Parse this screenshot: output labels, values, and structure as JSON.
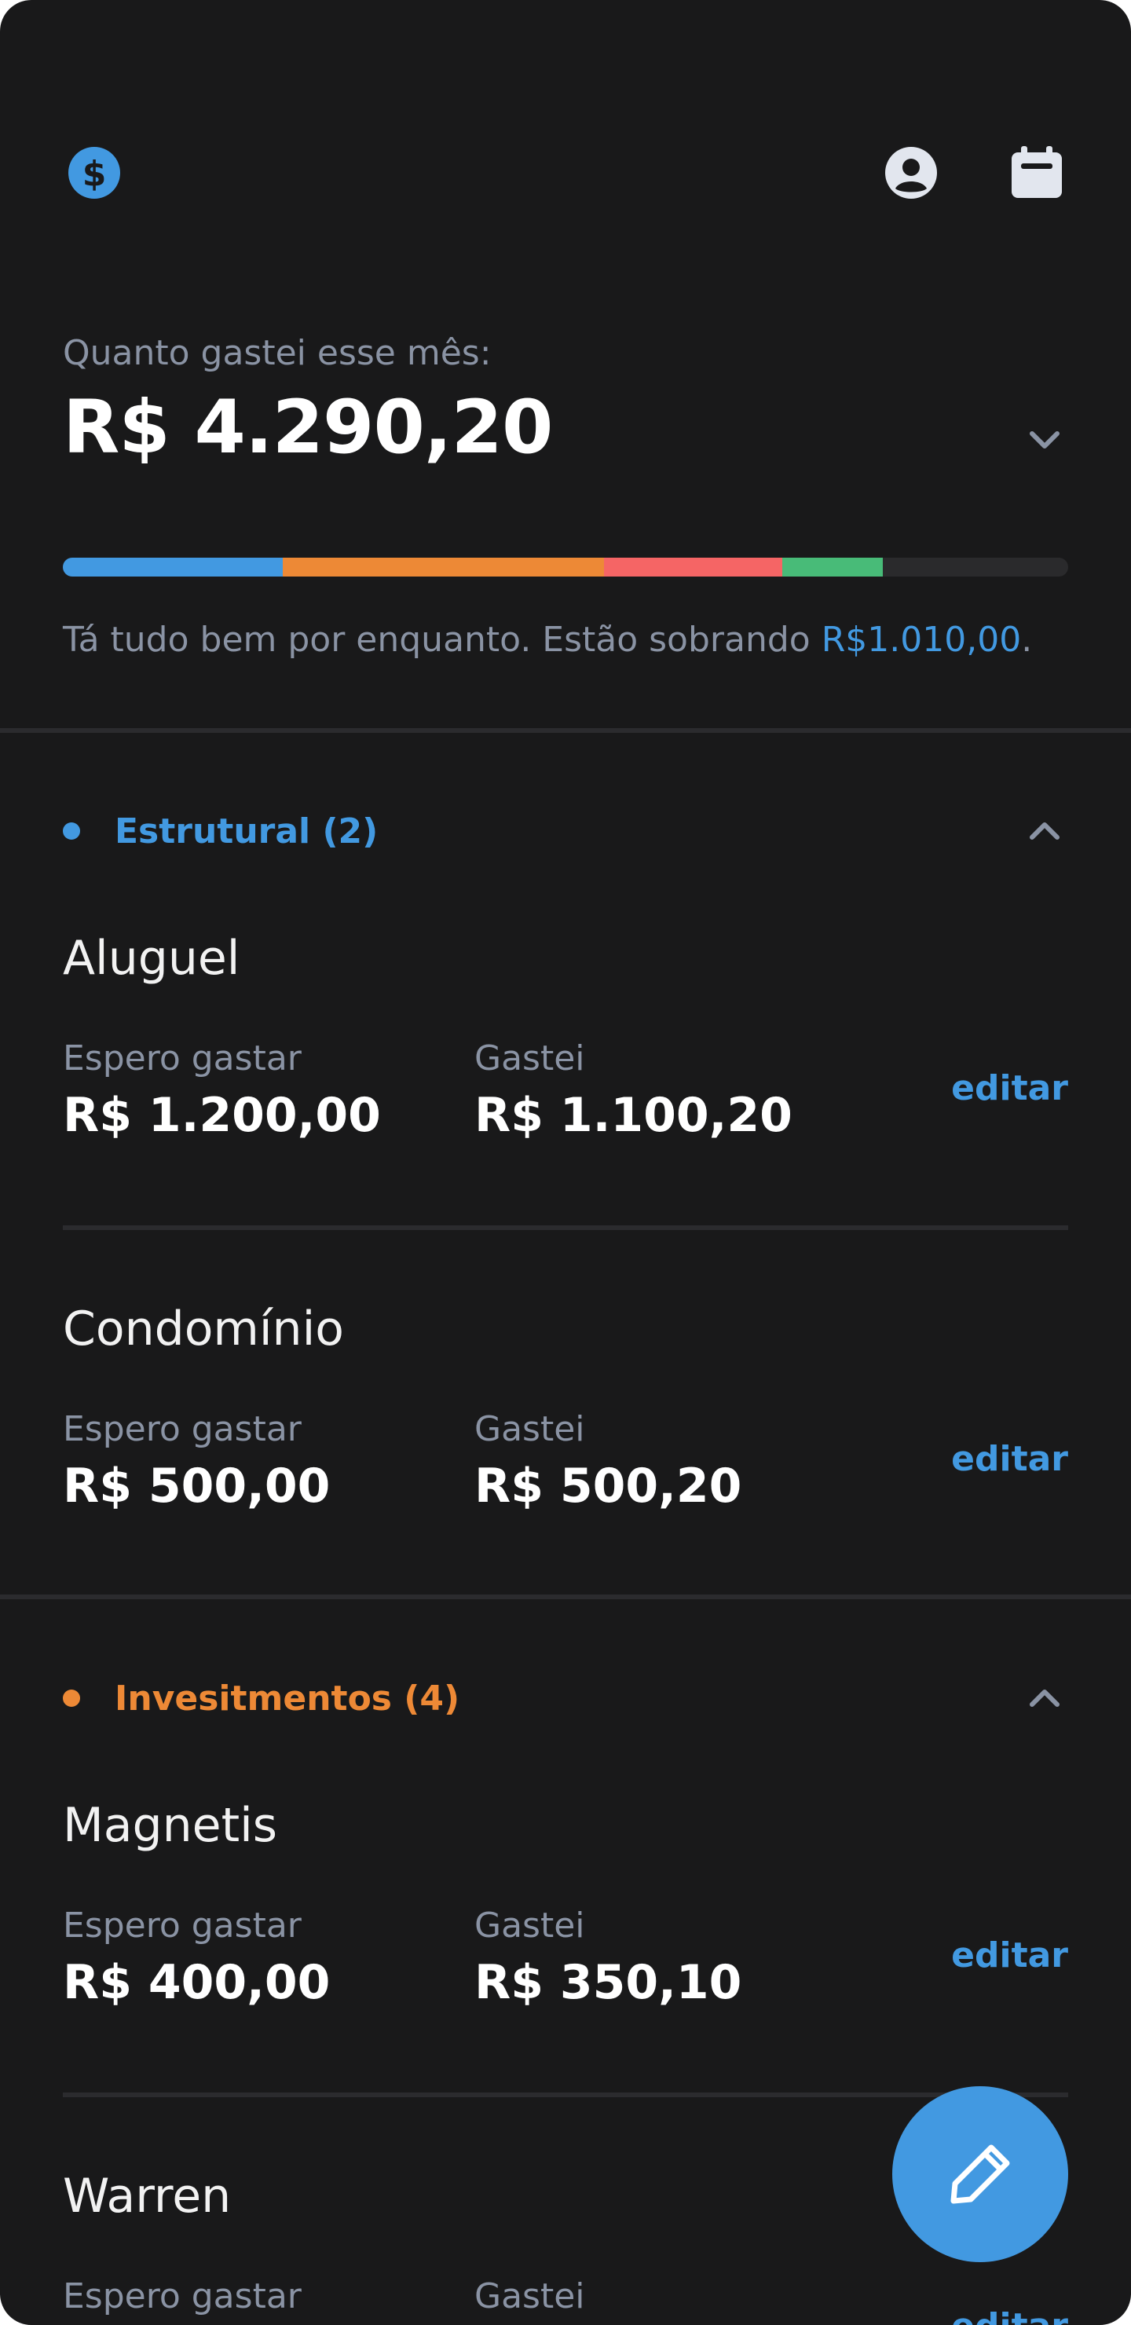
{
  "colors": {
    "background": "#19191a",
    "accent": "#4299e1",
    "orange": "#ed8936",
    "red": "#f56565",
    "green": "#48bb78",
    "muted": "#8a93a4"
  },
  "header": {
    "logo_icon": "dollar-circle-icon",
    "profile_icon": "user-circle-icon",
    "calendar_icon": "calendar-icon"
  },
  "summary": {
    "label": "Quanto gastei esse mês:",
    "total": "R$ 4.290,20",
    "status_prefix": "Tá tudo bem por enquanto. Estão sobrando ",
    "status_amount": "R$1.010,00",
    "status_suffix": ".",
    "budget_segments": [
      {
        "share": 0.219,
        "color": "#4299e1"
      },
      {
        "share": 0.319,
        "color": "#ed8936"
      },
      {
        "share": 0.178,
        "color": "#f56565"
      },
      {
        "share": 0.1,
        "color": "#48bb78"
      }
    ]
  },
  "groups": [
    {
      "title": "Estrutural (2)",
      "color": "#4299e1",
      "items": [
        {
          "name": "Aluguel",
          "expected_label": "Espero gastar",
          "expected": "R$ 1.200,00",
          "spent_label": "Gastei",
          "spent": "R$ 1.100,20",
          "edit": "editar"
        },
        {
          "name": "Condomínio",
          "expected_label": "Espero gastar",
          "expected": "R$ 500,00",
          "spent_label": "Gastei",
          "spent": "R$ 500,20",
          "edit": "editar"
        }
      ]
    },
    {
      "title": "Invesitmentos (4)",
      "color": "#ed8936",
      "items": [
        {
          "name": "Magnetis",
          "expected_label": "Espero gastar",
          "expected": "R$ 400,00",
          "spent_label": "Gastei",
          "spent": "R$ 350,10",
          "edit": "editar"
        },
        {
          "name": "Warren",
          "expected_label": "Espero gastar",
          "expected": "",
          "spent_label": "Gastei",
          "spent": "",
          "edit": "editar"
        }
      ]
    }
  ],
  "fab": {
    "icon": "pencil-icon"
  }
}
